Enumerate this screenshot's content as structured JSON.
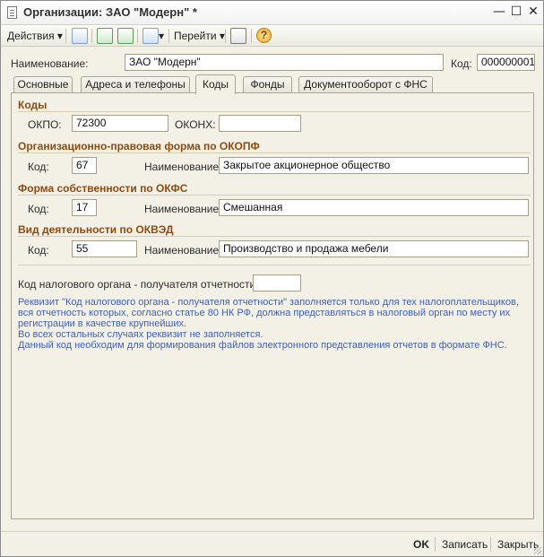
{
  "window": {
    "title": "Организации: ЗАО \"Модерн\" *",
    "minimize": "—",
    "maximize": "☐",
    "close": "✕"
  },
  "toolbar": {
    "actions_label": "Действия",
    "actions_arrow": "▾",
    "goto_label": "Перейти",
    "goto_arrow": "▾",
    "help_symbol": "?"
  },
  "header": {
    "name_label": "Наименование:",
    "name_value": "ЗАО \"Модерн\"",
    "code_label": "Код:",
    "code_value": "000000001"
  },
  "tabs": [
    {
      "label": "Основные"
    },
    {
      "label": "Адреса и телефоны"
    },
    {
      "label": "Коды"
    },
    {
      "label": "Фонды"
    },
    {
      "label": "Документооборот с ФНС"
    }
  ],
  "codes": {
    "section_title": "Коды",
    "okpo_label": "ОКПО:",
    "okpo_value": "72300",
    "okonh_label": "ОКОНХ:",
    "okonh_value": ""
  },
  "okopf": {
    "section_title": "Организационно-правовая форма по ОКОПФ",
    "code_label": "Код:",
    "code_value": "67",
    "name_label": "Наименование:",
    "name_value": "Закрытое акционерное общество"
  },
  "okfs": {
    "section_title": "Форма собственности по ОКФС",
    "code_label": "Код:",
    "code_value": "17",
    "name_label": "Наименование:",
    "name_value": "Смешанная"
  },
  "okved": {
    "section_title": "Вид деятельности по ОКВЭД",
    "code_label": "Код:",
    "code_value": "55",
    "name_label": "Наименование:",
    "name_value": "Производство и продажа мебели"
  },
  "tax_office": {
    "label": "Код налогового органа - получателя отчетности:",
    "value": "",
    "note_lines": [
      "Реквизит \"Код налогового органа - получателя отчетности\" заполняется только для тех налогоплательщиков,",
      "вся отчетность которых, согласно статье 80 НК РФ, должна представляться в налоговый орган по месту их",
      "регистрации в качестве крупнейших.",
      "Во всех остальных случаях реквизит не заполняется.",
      "Данный код необходим для формирования файлов электронного представления отчетов в формате ФНС."
    ],
    "note_color": "#3f5fbf"
  },
  "footer": {
    "ok_label": "OK",
    "save_label": "Записать",
    "close_label": "Закрыть"
  },
  "colors": {
    "section_title": "#8f4a10",
    "background": "#f3f1e6"
  }
}
